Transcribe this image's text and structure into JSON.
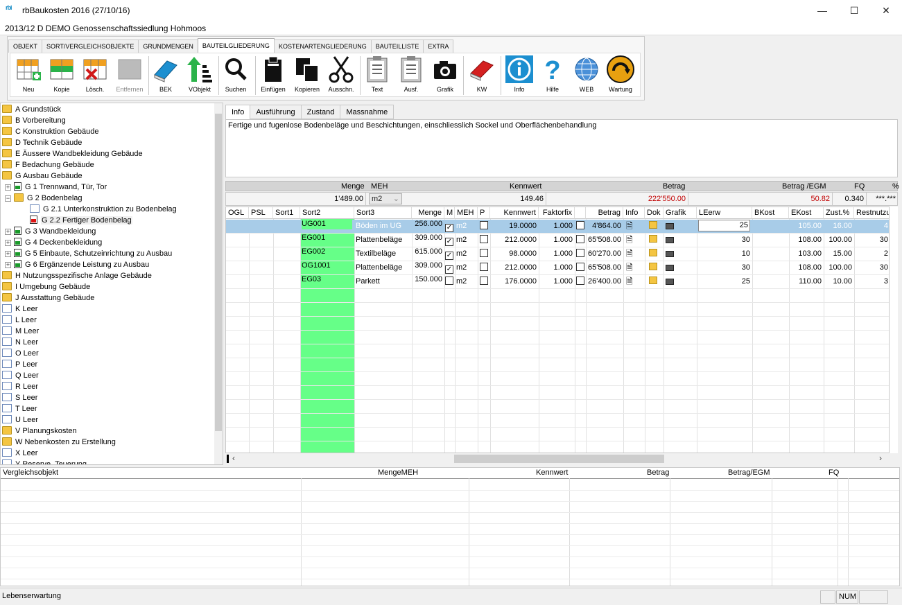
{
  "window": {
    "logo": "rbi",
    "title": "rbBaukosten 2016 (27/10/16)",
    "minimize": "—",
    "maximize": "☐",
    "close": "✕"
  },
  "project": {
    "title": "2013/12 D DEMO Genossenschaftssiedlung Hohmoos"
  },
  "ribbon_tabs": [
    "OBJEKT",
    "SORT/VERGLEICHSOBJEKTE",
    "GRUNDMENGEN",
    "BAUTEILGLIEDERUNG",
    "KOSTENARTENGLIEDERUNG",
    "BAUTEILLISTE",
    "EXTRA"
  ],
  "toolbar": {
    "neu": "Neu",
    "kopie": "Kopie",
    "loesch": "Lösch.",
    "entfernen": "Entfernen",
    "bek": "BEK",
    "vobjekt": "VObjekt",
    "suchen": "Suchen",
    "einfuegen": "Einfügen",
    "kopieren": "Kopieren",
    "ausschn": "Ausschn.",
    "text": "Text",
    "ausf": "Ausf.",
    "grafik": "Grafik",
    "kw": "KW",
    "info": "Info",
    "hilfe": "Hilfe",
    "web": "WEB",
    "wartung": "Wartung"
  },
  "tree": [
    {
      "label": "A Grundstück",
      "icon": "folder",
      "level": 0
    },
    {
      "label": "B Vorbereitung",
      "icon": "folder",
      "level": 0
    },
    {
      "label": "C Konstruktion Gebäude",
      "icon": "folder",
      "level": 0
    },
    {
      "label": "D Technik Gebäude",
      "icon": "folder",
      "level": 0
    },
    {
      "label": "E Äussere Wandbekleidung Gebäude",
      "icon": "folder",
      "level": 0
    },
    {
      "label": "F Bedachung Gebäude",
      "icon": "folder",
      "level": 0
    },
    {
      "label": "G Ausbau Gebäude",
      "icon": "folder",
      "level": 0
    },
    {
      "label": "G 1 Trennwand, Tür, Tor",
      "icon": "green",
      "level": 1,
      "exp": "+"
    },
    {
      "label": "G 2 Bodenbelag",
      "icon": "folder",
      "level": 1,
      "exp": "−"
    },
    {
      "label": "G 2.1 Unterkonstruktion zu Bodenbelag",
      "icon": "doc",
      "level": 2
    },
    {
      "label": "G 2.2 Fertiger Bodenbelag",
      "icon": "red",
      "level": 2
    },
    {
      "label": "G 3 Wandbekleidung",
      "icon": "green",
      "level": 1,
      "exp": "+"
    },
    {
      "label": "G 4 Deckenbekleidung",
      "icon": "green",
      "level": 1,
      "exp": "+"
    },
    {
      "label": "G 5 Einbaute, Schutzeinrichtung zu Ausbau",
      "icon": "green",
      "level": 1,
      "exp": "+"
    },
    {
      "label": "G 6 Ergänzende Leistung zu Ausbau",
      "icon": "green",
      "level": 1,
      "exp": "+"
    },
    {
      "label": "H Nutzungsspezifische Anlage Gebäude",
      "icon": "folder",
      "level": 0
    },
    {
      "label": "I Umgebung Gebäude",
      "icon": "folder",
      "level": 0
    },
    {
      "label": "J Ausstattung Gebäude",
      "icon": "folder",
      "level": 0
    },
    {
      "label": "K Leer",
      "icon": "doc",
      "level": 0
    },
    {
      "label": "L Leer",
      "icon": "doc",
      "level": 0
    },
    {
      "label": "M Leer",
      "icon": "doc",
      "level": 0
    },
    {
      "label": "N Leer",
      "icon": "doc",
      "level": 0
    },
    {
      "label": "O Leer",
      "icon": "doc",
      "level": 0
    },
    {
      "label": "P Leer",
      "icon": "doc",
      "level": 0
    },
    {
      "label": "Q Leer",
      "icon": "doc",
      "level": 0
    },
    {
      "label": "R Leer",
      "icon": "doc",
      "level": 0
    },
    {
      "label": "S Leer",
      "icon": "doc",
      "level": 0
    },
    {
      "label": "T Leer",
      "icon": "doc",
      "level": 0
    },
    {
      "label": "U Leer",
      "icon": "doc",
      "level": 0
    },
    {
      "label": "V Planungskosten",
      "icon": "folder",
      "level": 0
    },
    {
      "label": "W Nebenkosten zu Erstellung",
      "icon": "folder",
      "level": 0
    },
    {
      "label": "X Leer",
      "icon": "doc",
      "level": 0
    },
    {
      "label": "Y Reserve, Teuerung",
      "icon": "doc",
      "level": 0
    }
  ],
  "info_tabs": [
    "Info",
    "Ausführung",
    "Zustand",
    "Massnahme"
  ],
  "info_text": "Fertige und fugenlose Bodenbeläge und Beschichtungen, einschliesslich Sockel und Oberflächenbehandlung",
  "summary": {
    "headers": {
      "menge": "Menge",
      "meh": "MEH",
      "kennwert": "Kennwert",
      "betrag": "Betrag",
      "betrag_egm": "Betrag /EGM",
      "fq": "FQ",
      "pct": "%"
    },
    "values": {
      "menge": "1'489.00",
      "meh": "m2",
      "kennwert": "149.46",
      "betrag": "222'550.00",
      "betrag_egm": "50.82",
      "fq": "0.340",
      "pct": "***.***"
    },
    "highlight_color": "#c00000"
  },
  "grid": {
    "headers": [
      "OGL",
      "PSL",
      "Sort1",
      "Sort2",
      "Sort3",
      "Menge",
      "M",
      "MEH",
      "P",
      "Kennwert",
      "Faktorfix",
      "",
      "Betrag",
      "Info",
      "Dok",
      "Grafik",
      "LEerw",
      "BKost",
      "EKost",
      "Zust.%",
      "Restnutzu"
    ],
    "rows": [
      {
        "sort2": "UG001",
        "sort3": "Böden im UG",
        "menge": "256.000",
        "m": true,
        "meh": "m2",
        "p": false,
        "kennwert": "19.0000",
        "faktor": "1.000",
        "ff": false,
        "betrag": "4'864.00",
        "leerw": "25",
        "bkost": "",
        "ekost": "105.00",
        "zust": "16.00",
        "rest": "4",
        "selected": true
      },
      {
        "sort2": "EG001",
        "sort3": "Plattenbeläge",
        "menge": "309.000",
        "m": true,
        "meh": "m2",
        "p": false,
        "kennwert": "212.0000",
        "faktor": "1.000",
        "ff": false,
        "betrag": "65'508.00",
        "leerw": "30",
        "bkost": "",
        "ekost": "108.00",
        "zust": "100.00",
        "rest": "30"
      },
      {
        "sort2": "EG002",
        "sort3": "Textilbeläge",
        "menge": "615.000",
        "m": true,
        "meh": "m2",
        "p": false,
        "kennwert": "98.0000",
        "faktor": "1.000",
        "ff": false,
        "betrag": "60'270.00",
        "leerw": "10",
        "bkost": "",
        "ekost": "103.00",
        "zust": "15.00",
        "rest": "2"
      },
      {
        "sort2": "OG1001",
        "sort3": "Plattenbeläge",
        "menge": "309.000",
        "m": true,
        "meh": "m2",
        "p": false,
        "kennwert": "212.0000",
        "faktor": "1.000",
        "ff": false,
        "betrag": "65'508.00",
        "leerw": "30",
        "bkost": "",
        "ekost": "108.00",
        "zust": "100.00",
        "rest": "30"
      },
      {
        "sort2": "EG03",
        "sort3": "Parkett",
        "menge": "150.000",
        "m": false,
        "meh": "m2",
        "p": false,
        "kennwert": "176.0000",
        "faktor": "1.000",
        "ff": false,
        "betrag": "26'400.00",
        "leerw": "25",
        "bkost": "",
        "ekost": "110.00",
        "zust": "10.00",
        "rest": "3"
      }
    ],
    "sort2_color": "#66ff88",
    "selected_color": "#a8cce8"
  },
  "vergleich": {
    "headers": {
      "objekt": "Vergleichsobjekt",
      "menge": "MengeMEH",
      "kennwert": "Kennwert",
      "betrag": "Betrag",
      "betrag_egm": "Betrag/EGM",
      "fq": "FQ"
    }
  },
  "status": {
    "text": "Lebenserwartung",
    "num": "NUM"
  }
}
